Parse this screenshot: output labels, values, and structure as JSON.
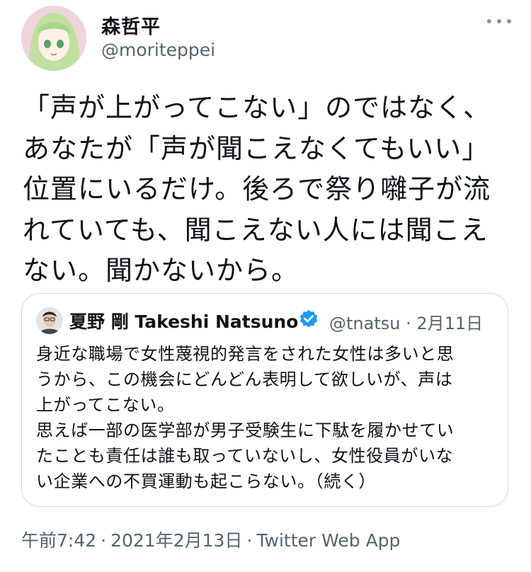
{
  "author": {
    "name": "森哲平",
    "handle": "@moriteppei",
    "avatar_icon": "anime-girl-avatar-icon"
  },
  "tweet": {
    "text": "「声が上がってこない」のではなく、\nあなたが「声が聞こえなくてもいい」\n位置にいるだけ。後ろで祭り囃子が流\nれていても、聞こえない人には聞こえ\nない。聞かないから。"
  },
  "quote": {
    "author_name": "夏野 剛 Takeshi Natsuno",
    "handle_date": "@tnatsu · 2月11日",
    "verified_icon": "verified-badge-icon",
    "text": "身近な職場で女性蔑視的発言をされた女性は多いと思\nうから、この機会にどんどん表明して欲しいが、声は\n上がってこない。\n思えば一部の医学部が男子受験生に下駄を履かせてい\nたことも責任は誰も取っていないし、女性役員がいな\nい企業への不買運動も起こらない。（続く）"
  },
  "meta": {
    "time": "午前7:42",
    "separator": "·",
    "date": "2021年2月13日",
    "source": "Twitter Web App"
  },
  "colors": {
    "text": "#0f1419",
    "secondary": "#536471",
    "verified": "#1d9bf0",
    "border": "#cfd9de"
  }
}
